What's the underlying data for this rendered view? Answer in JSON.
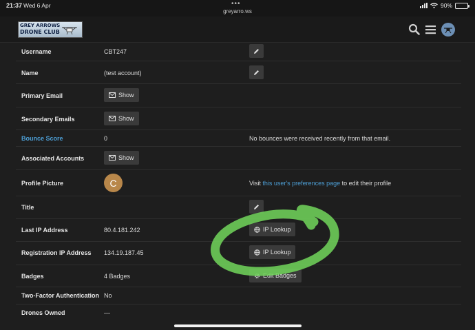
{
  "status_bar": {
    "time": "21:37",
    "date": "Wed 6 Apr",
    "url": "greyarro.ws",
    "battery": "90%",
    "battery_level": 0.9
  },
  "header": {
    "logo_line1": "GREY ARROWS",
    "logo_line2": "DRONE CLUB",
    "icons": [
      "search-icon",
      "menu-icon",
      "user-avatar"
    ]
  },
  "profile": {
    "username": {
      "label": "Username",
      "value": "CBT247"
    },
    "name": {
      "label": "Name",
      "value": "(test account)"
    },
    "primary_email": {
      "label": "Primary Email",
      "button": "Show"
    },
    "secondary_emails": {
      "label": "Secondary Emails",
      "button": "Show"
    },
    "bounce_score": {
      "label": "Bounce Score",
      "value": "0",
      "note": "No bounces were received recently from that email."
    },
    "associated_accounts": {
      "label": "Associated Accounts",
      "button": "Show"
    },
    "profile_picture": {
      "label": "Profile Picture",
      "initial": "C",
      "note_pre": "Visit ",
      "note_link": "this user's preferences page",
      "note_post": " to edit their profile"
    },
    "title": {
      "label": "Title"
    },
    "last_ip": {
      "label": "Last IP Address",
      "value": "80.4.181.242",
      "button": "IP Lookup"
    },
    "registration_ip": {
      "label": "Registration IP Address",
      "value": "134.19.187.45",
      "button": "IP Lookup"
    },
    "badges": {
      "label": "Badges",
      "value": "4 Badges",
      "button": "Edit Badges"
    },
    "two_factor": {
      "label": "Two-Factor Authentication",
      "value": "No"
    },
    "drones_owned": {
      "label": "Drones Owned",
      "value": "—"
    }
  },
  "colors": {
    "background": "#1e1e1e",
    "link": "#4d9fd6",
    "button": "#3a3a3a",
    "highlight_scribble": "#6fd15a",
    "avatar": "#b8874a"
  }
}
